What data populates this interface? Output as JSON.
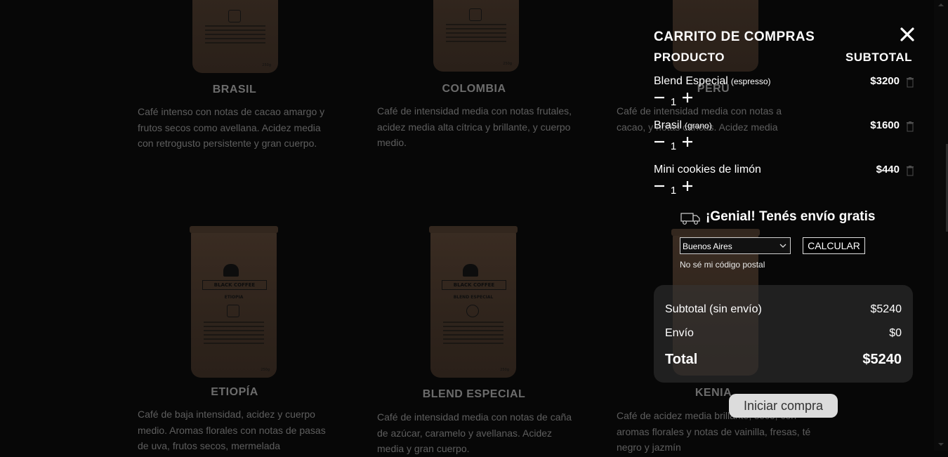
{
  "catalog": {
    "products": [
      {
        "title": "BRASIL",
        "variety": "",
        "description": "Café intenso con notas de cacao amargo y frutos secos como avellana. Acidez media con retrogusto persistente y gran cuerpo."
      },
      {
        "title": "COLOMBIA",
        "variety": "",
        "description": "Café de intensidad media con notas frutales, acidez media alta cítrica y brillante, y cuerpo medio."
      },
      {
        "title": "PERÚ",
        "variety": "",
        "description": "Café de intensidad media con notas a cacao, y notas cítricas. Acidez media"
      },
      {
        "title": "ETIOPÍA",
        "variety": "ETIOPIA",
        "description": "Café de baja intensidad, acidez y cuerpo medio. Aromas florales con notas de pasas de uva, frutos secos, mermelada"
      },
      {
        "title": "BLEND ESPECIAL",
        "variety": "BLEND ESPECIAL",
        "description": "Café de intensidad media con notas de caña de azúcar, caramelo y avellanas. Acidez media y gran cuerpo."
      },
      {
        "title": "KENIA",
        "variety": "",
        "description": "Café de acidez media brillante, seco, con aromas florales y notas de vainilla, fresas, té negro y jazmín"
      }
    ],
    "bag_brand": "BLACK COFFEE",
    "bag_weight": "250g"
  },
  "cart": {
    "title": "CARRITO DE COMPRAS",
    "col_product": "PRODUCTO",
    "col_subtotal": "SUBTOTAL",
    "items": [
      {
        "name": "Blend Especial",
        "variant": "(espresso)",
        "price": "$3200",
        "qty": "1"
      },
      {
        "name": "Brasil",
        "variant": "(grano)",
        "price": "$1600",
        "qty": "1"
      },
      {
        "name": "Mini cookies de limón",
        "variant": "",
        "price": "$440",
        "qty": "1"
      }
    ],
    "shipping_message": "¡Genial! Tenés envío gratis",
    "province_selected": "Buenos Aires",
    "calculate_label": "CALCULAR",
    "postal_link": "No sé mi código postal",
    "summary": {
      "subtotal_label": "Subtotal (sin envío)",
      "subtotal_value": "$5240",
      "shipping_label": "Envío",
      "shipping_value": "$0",
      "total_label": "Total",
      "total_value": "$5240"
    },
    "checkout_label": "Iniciar compra"
  }
}
